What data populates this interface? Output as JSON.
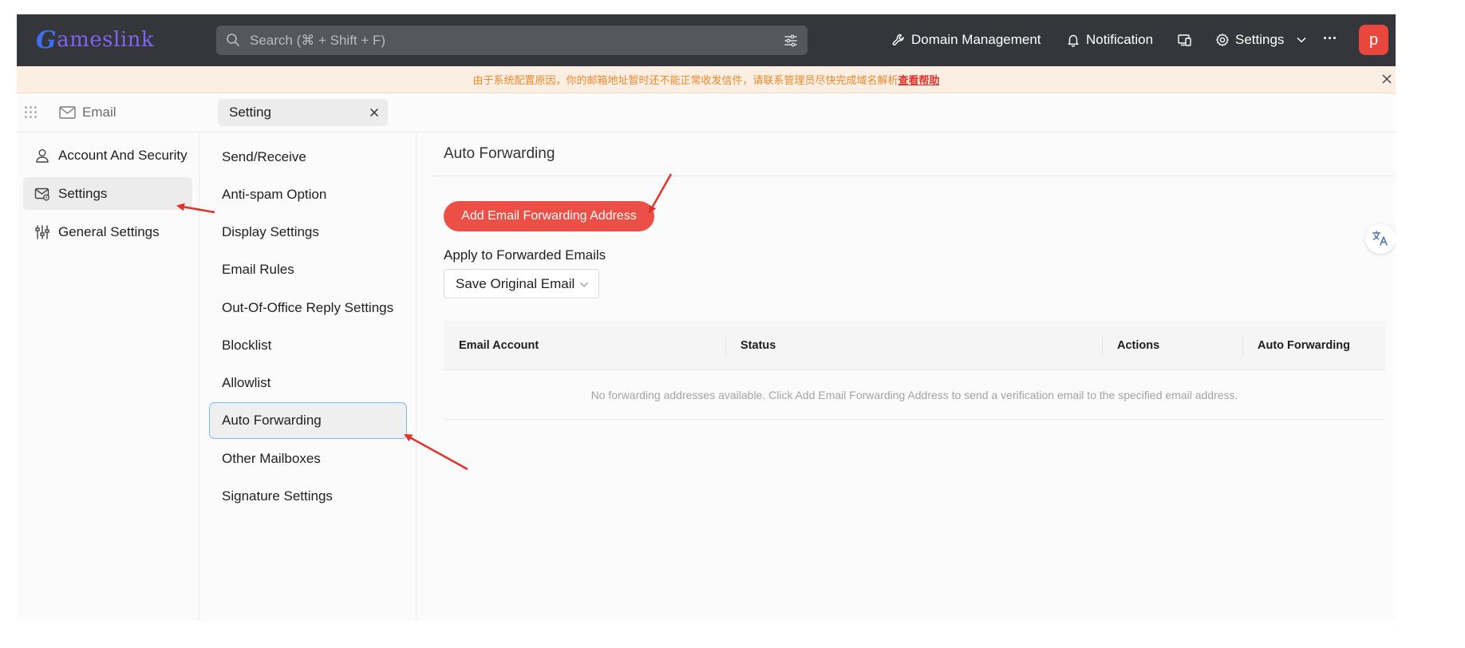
{
  "header": {
    "logo_initial": "G",
    "logo_rest": "ameslink",
    "search_placeholder": "Search (⌘ + Shift + F)",
    "domain_management_label": "Domain Management",
    "notification_label": "Notification",
    "settings_label": "Settings",
    "more_label": "···",
    "avatar_letter": "p",
    "icons": {
      "search": "search-icon",
      "filter": "sliders-icon",
      "domain": "wrench-icon",
      "notification": "bell-icon",
      "device": "devices-icon",
      "settings": "gear-icon",
      "dropdown": "chevron-down-icon",
      "more": "more-icon"
    }
  },
  "notice": {
    "text": "由于系统配置原因，你的邮箱地址暂时还不能正常收发信件，请联系管理员尽快完成域名解析",
    "link_text": "查看帮助"
  },
  "tabs": {
    "app_label": "Email",
    "active_tab": "Setting"
  },
  "sidebar": {
    "items": [
      {
        "label": "Account And Security",
        "icon": "user-icon"
      },
      {
        "label": "Settings",
        "icon": "mail-settings-icon",
        "active": true
      },
      {
        "label": "General Settings",
        "icon": "sliders-icon"
      }
    ]
  },
  "submenu": {
    "items": [
      {
        "label": "Send/Receive"
      },
      {
        "label": "Anti-spam Option"
      },
      {
        "label": "Display Settings"
      },
      {
        "label": "Email Rules"
      },
      {
        "label": "Out-Of-Office Reply Settings"
      },
      {
        "label": "Blocklist"
      },
      {
        "label": "Allowlist"
      },
      {
        "label": "Auto Forwarding",
        "active": true
      },
      {
        "label": "Other Mailboxes"
      },
      {
        "label": "Signature Settings"
      }
    ]
  },
  "main": {
    "title": "Auto Forwarding",
    "add_button_label": "Add Email Forwarding Address",
    "apply_label": "Apply to Forwarded Emails",
    "apply_select_value": "Save Original Email",
    "table": {
      "columns": [
        "Email Account",
        "Status",
        "Actions",
        "Auto Forwarding"
      ],
      "empty_text": "No forwarding addresses available. Click Add Email Forwarding Address to send a verification email to the specified email address."
    }
  },
  "colors": {
    "topbar": "#34363b",
    "accent": "#ec4f46",
    "notice_bg": "#fbeee3",
    "notice_text": "#e98a2b",
    "active_border": "#7db6f2",
    "annotation_arrow": "#e5312c"
  }
}
